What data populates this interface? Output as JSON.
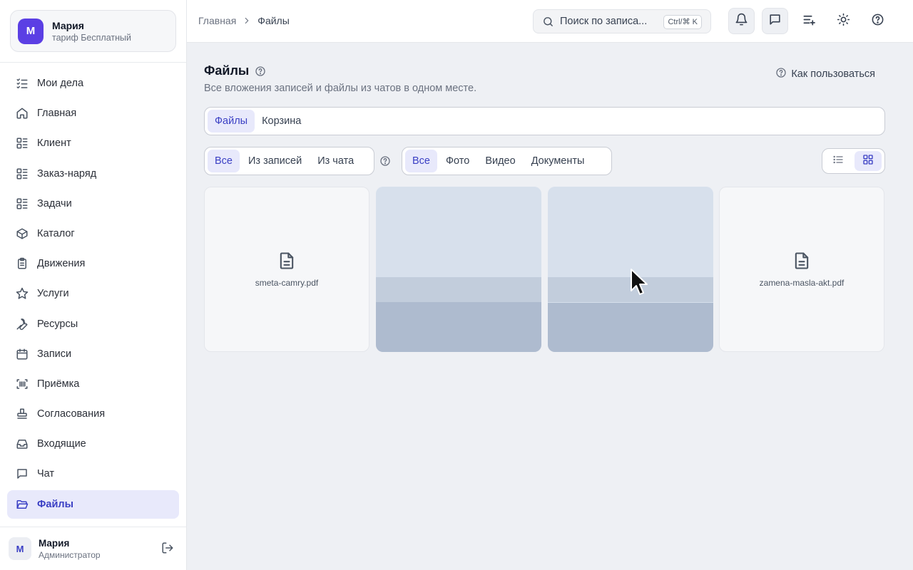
{
  "account": {
    "initial": "М",
    "name": "Мария",
    "plan": "тариф Бесплатный"
  },
  "nav": [
    {
      "label": "Мои дела",
      "icon": "task-list-icon"
    },
    {
      "label": "Главная",
      "icon": "home-icon"
    },
    {
      "label": "Клиент",
      "icon": "list-grid-icon"
    },
    {
      "label": "Заказ-наряд",
      "icon": "list-grid-icon"
    },
    {
      "label": "Задачи",
      "icon": "list-grid-icon"
    },
    {
      "label": "Каталог",
      "icon": "box-icon"
    },
    {
      "label": "Движения",
      "icon": "clipboard-icon"
    },
    {
      "label": "Услуги",
      "icon": "star-icon"
    },
    {
      "label": "Ресурсы",
      "icon": "wrench-icon"
    },
    {
      "label": "Записи",
      "icon": "calendar-icon"
    },
    {
      "label": "Приёмка",
      "icon": "scan-icon"
    },
    {
      "label": "Согласования",
      "icon": "stamp-icon"
    },
    {
      "label": "Входящие",
      "icon": "inbox-icon"
    },
    {
      "label": "Чат",
      "icon": "chat-icon"
    },
    {
      "label": "Файлы",
      "icon": "folder-icon",
      "active": true
    }
  ],
  "user": {
    "initial": "М",
    "name": "Мария",
    "role": "Администратор"
  },
  "breadcrumb": {
    "home": "Главная",
    "current": "Файлы"
  },
  "search": {
    "placeholder": "Поиск по записа...",
    "shortcut": "Ctrl/⌘ K"
  },
  "page": {
    "title": "Файлы",
    "subtitle": "Все вложения записей и файлы из чатов в одном месте.",
    "howto": "Как пользоваться"
  },
  "tabs": {
    "files": "Файлы",
    "trash": "Корзина"
  },
  "source_filter": {
    "all": "Все",
    "records": "Из записей",
    "chat": "Из чата"
  },
  "type_filter": {
    "all": "Все",
    "photo": "Фото",
    "video": "Видео",
    "docs": "Документы"
  },
  "files": [
    {
      "kind": "doc",
      "name": "smeta-camry.pdf"
    },
    {
      "kind": "image"
    },
    {
      "kind": "image"
    },
    {
      "kind": "doc",
      "name": "zamena-masla-akt.pdf"
    }
  ],
  "colors": {
    "accent": "#3a3fc4",
    "accent_bg": "#e8e9fb",
    "avatar": "#5b3fe4"
  }
}
